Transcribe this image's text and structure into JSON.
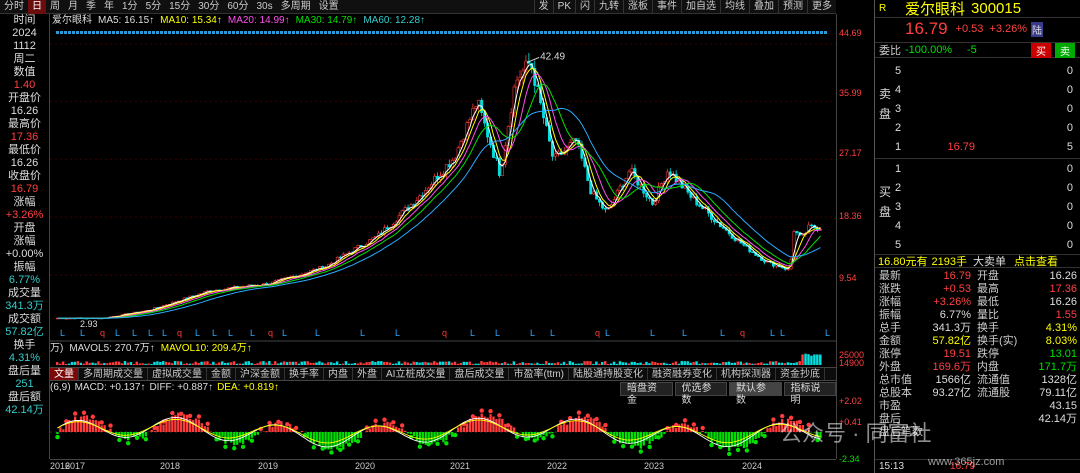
{
  "toolbar": {
    "periods": [
      "分时",
      "日",
      "周",
      "月",
      "季",
      "年",
      "1分",
      "5分",
      "15分",
      "30分",
      "60分",
      "30s",
      "多周期",
      "设置"
    ],
    "active_period": "日",
    "tools": [
      "发",
      "PK",
      "闪",
      "九转",
      "涨板",
      "事件",
      "加自选",
      "均线",
      "叠加",
      "预测",
      "更多"
    ]
  },
  "left_info": [
    {
      "text": "时间",
      "color": "w"
    },
    {
      "text": "2024",
      "color": "w"
    },
    {
      "text": "1112",
      "color": "w"
    },
    {
      "text": "周二",
      "color": "w"
    },
    {
      "text": "数值",
      "color": "w"
    },
    {
      "text": "1.40",
      "color": "r"
    },
    {
      "text": "开盘价",
      "color": "w"
    },
    {
      "text": "16.26",
      "color": "w"
    },
    {
      "text": "最高价",
      "color": "w"
    },
    {
      "text": "17.36",
      "color": "r"
    },
    {
      "text": "最低价",
      "color": "w"
    },
    {
      "text": "16.26",
      "color": "w"
    },
    {
      "text": "收盘价",
      "color": "w"
    },
    {
      "text": "16.79",
      "color": "r"
    },
    {
      "text": "涨幅",
      "color": "w"
    },
    {
      "text": "+3.26%",
      "color": "r"
    },
    {
      "text": "开盘",
      "color": "w"
    },
    {
      "text": "涨幅",
      "color": "w"
    },
    {
      "text": "+0.00%",
      "color": "w"
    },
    {
      "text": "振幅",
      "color": "w"
    },
    {
      "text": "6.77%",
      "color": "c"
    },
    {
      "text": "成交量",
      "color": "w"
    },
    {
      "text": "341.3万",
      "color": "c"
    },
    {
      "text": "成交额",
      "color": "w"
    },
    {
      "text": "57.82亿",
      "color": "c"
    },
    {
      "text": "换手",
      "color": "w"
    },
    {
      "text": "4.31%",
      "color": "c"
    },
    {
      "text": "盘后量",
      "color": "w"
    },
    {
      "text": "251",
      "color": "c"
    },
    {
      "text": "盘后额",
      "color": "w"
    },
    {
      "text": "42.14万",
      "color": "c"
    }
  ],
  "ma_legend": {
    "name": "爱尔眼科",
    "ma5": "MA5: 16.15↑",
    "ma10": "MA10: 15.34↑",
    "ma20": "MA20: 14.99↑",
    "ma30": "MA30: 14.79↑",
    "ma60": "MA60: 12.28↑"
  },
  "price_axis": [
    "44.69",
    "35.99",
    "27.17",
    "18.36",
    "9.54"
  ],
  "peak_label": "42.49",
  "low_label": "2.93",
  "vol_legend": {
    "unit": "万)",
    "mavol5": "MAVOL5: 270.7万↑",
    "mavol10": "MAVOL10: 209.4万↑",
    "axis_top": "25000",
    "axis_bottom": "14900"
  },
  "indicator_tabs": [
    "文量",
    "多周期成交量",
    "虚拟成交量",
    "金额",
    "沪深金额",
    "换手率",
    "内盘",
    "外盘",
    "AI立桩成交量",
    "盘后成交量",
    "市盈率(ttm)",
    "陆股通持股变化",
    "融资融券变化",
    "机构探测器",
    "资金抄底"
  ],
  "active_tab": "文量",
  "macd_legend": {
    "params": "(6,9)",
    "macd": "MACD: +0.137↑",
    "diff": "DIFF: +0.887↑",
    "dea": "DEA: +0.819↑"
  },
  "macd_buttons": [
    "暗盘资金",
    "优选参数",
    "默认参数",
    "指标说明"
  ],
  "macd_axis": [
    "+2.02",
    "+0.41",
    "-2.34"
  ],
  "years": [
    "2016",
    "2017",
    "2018",
    "2019",
    "2020",
    "2021",
    "2022",
    "2023",
    "2024"
  ],
  "quote": {
    "market": "R",
    "name": "爱尔眼科",
    "code": "300015",
    "price": "16.79",
    "change": "+0.53",
    "pct": "+3.26%",
    "tag": "陆",
    "weibi_label": "委比",
    "weibi": "-100.00%",
    "weicha": "-5",
    "buy_btn": "买",
    "sell_btn": "卖"
  },
  "order_book": {
    "sell_label": "卖盘",
    "buy_label": "买盘",
    "sells": [
      {
        "level": "5",
        "price": "",
        "vol": "0"
      },
      {
        "level": "4",
        "price": "",
        "vol": "0"
      },
      {
        "level": "3",
        "price": "",
        "vol": "0"
      },
      {
        "level": "2",
        "price": "",
        "vol": "0"
      },
      {
        "level": "1",
        "price": "16.79",
        "vol": "5"
      }
    ],
    "buys": [
      {
        "level": "1",
        "price": "",
        "vol": "0"
      },
      {
        "level": "2",
        "price": "",
        "vol": "0"
      },
      {
        "level": "3",
        "price": "",
        "vol": "0"
      },
      {
        "level": "4",
        "price": "",
        "vol": "0"
      },
      {
        "level": "5",
        "price": "",
        "vol": "0"
      }
    ]
  },
  "bigorder": {
    "price": "16.80元有",
    "vol": "2193手",
    "label": "大卖单",
    "link": "点击查看"
  },
  "stats": [
    {
      "k": "最新",
      "v": "16.79",
      "vc": "r",
      "k2": "开盘",
      "v2": "16.26",
      "v2c": "w"
    },
    {
      "k": "涨跌",
      "v": "+0.53",
      "vc": "r",
      "k2": "最高",
      "v2": "17.36",
      "v2c": "r"
    },
    {
      "k": "涨幅",
      "v": "+3.26%",
      "vc": "r",
      "k2": "最低",
      "v2": "16.26",
      "v2c": "w"
    },
    {
      "k": "振幅",
      "v": "6.77%",
      "vc": "w",
      "k2": "量比",
      "v2": "1.55",
      "v2c": "r"
    },
    {
      "k": "总手",
      "v": "341.3万",
      "vc": "w",
      "k2": "换手",
      "v2": "4.31%",
      "v2c": "y"
    },
    {
      "k": "金额",
      "v": "57.82亿",
      "vc": "y",
      "k2": "换手(实)",
      "v2": "8.03%",
      "v2c": "y"
    },
    {
      "k": "涨停",
      "v": "19.51",
      "vc": "r",
      "k2": "跌停",
      "v2": "13.01",
      "v2c": "g"
    },
    {
      "k": "外盘",
      "v": "169.6万",
      "vc": "r",
      "k2": "内盘",
      "v2": "171.7万",
      "v2c": "g"
    },
    {
      "k": "总市值",
      "v": "1566亿",
      "vc": "w",
      "k2": "流通值",
      "v2": "1328亿",
      "v2c": "w"
    },
    {
      "k": "总股本",
      "v": "93.27亿",
      "vc": "w",
      "k2": "流通股",
      "v2": "79.11亿",
      "v2c": "w"
    },
    {
      "k": "市盈",
      "v": "",
      "vc": "w",
      "k2": "",
      "v2": "43.15",
      "v2c": "w"
    },
    {
      "k": "盘后",
      "v": "",
      "vc": "w",
      "k2": "",
      "v2": "42.14万",
      "v2c": "w"
    },
    {
      "k": "盘后笔数",
      "v": "",
      "vc": "w",
      "k2": "",
      "v2": "",
      "v2c": "w"
    }
  ],
  "time": "15:13",
  "time_price": "16.79",
  "watermark": "公众号 · 同富社",
  "watermark_url": "www.365jz.com",
  "chart_data": {
    "type": "line",
    "title": "爱尔眼科 300015",
    "x": [
      "2016",
      "2017",
      "2018",
      "2019",
      "2020",
      "2021",
      "2022",
      "2023",
      "2024"
    ],
    "series": [
      {
        "name": "爱尔眼科",
        "values": [
          3.0,
          4.5,
          8.5,
          11.0,
          17.5,
          38.5,
          25.0,
          25.5,
          15.5
        ]
      }
    ],
    "ylim": [
      1.5,
      44.69
    ],
    "ytick_labels": [
      "44.69",
      "35.99",
      "27.17",
      "18.36",
      "9.54"
    ]
  }
}
